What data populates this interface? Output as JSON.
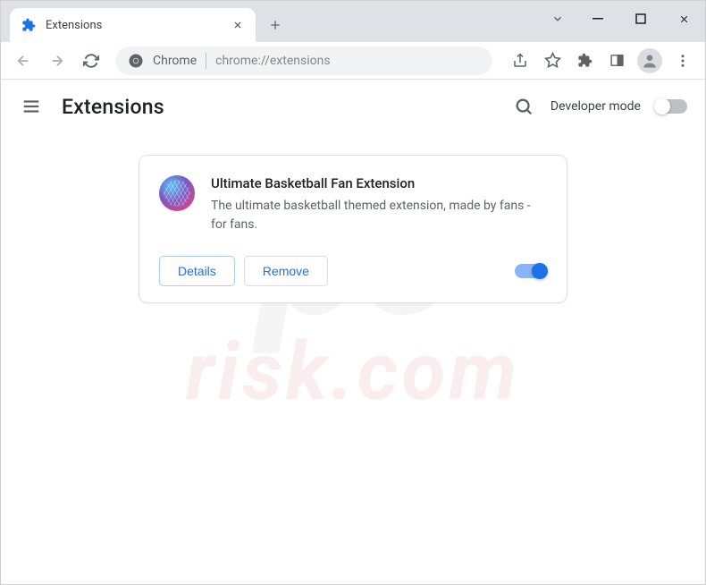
{
  "tab": {
    "title": "Extensions"
  },
  "omnibox": {
    "label": "Chrome",
    "url": "chrome://extensions"
  },
  "page": {
    "title": "Extensions",
    "dev_mode_label": "Developer mode"
  },
  "extension": {
    "name": "Ultimate Basketball Fan Extension",
    "description": "The ultimate basketball themed extension, made by fans - for fans.",
    "details_label": "Details",
    "remove_label": "Remove"
  },
  "watermark": {
    "top": "pc",
    "bottom": "risk.com"
  }
}
